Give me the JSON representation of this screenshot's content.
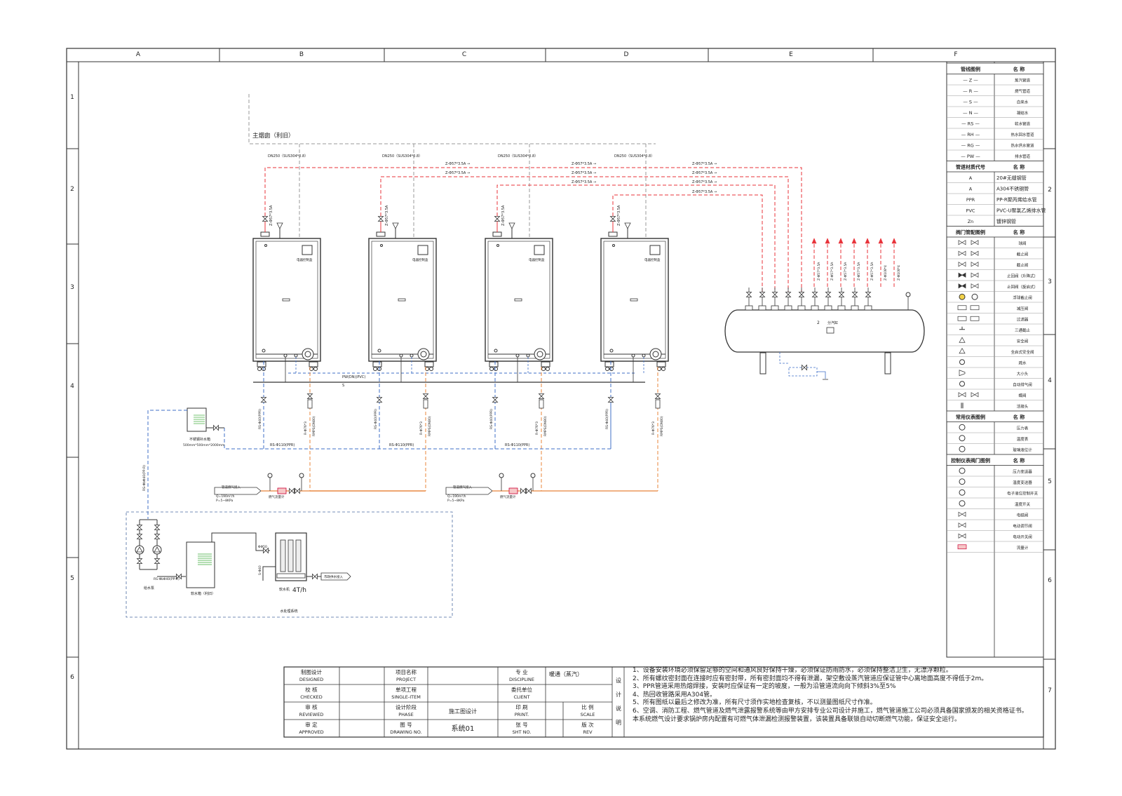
{
  "frame": {
    "columns": [
      "A",
      "B",
      "C",
      "D",
      "E",
      "F"
    ],
    "rows_left": [
      "1",
      "2",
      "3",
      "4",
      "5",
      "6"
    ],
    "rows_right": [
      "2",
      "3",
      "4",
      "5",
      "6",
      "7"
    ]
  },
  "top": {
    "main_flue": "主烟囱（利旧）",
    "flue_labels": [
      "DN250（SUS304*0.8）",
      "DN250（SUS304*0.8）",
      "DN250（SUS304*0.8）",
      "DN250（SUS304*0.8）"
    ],
    "steam_labels": [
      "Z-Φ57*3.5A →",
      "Z-Φ57*3.5A →",
      "Z-Φ57*3.5A →",
      "Z-Φ57*3.5A →",
      "Z-Φ57*3.5A →",
      "Z-Φ57*3.5A →",
      "Z-Φ57*3.5A →",
      "Z-Φ57*3.5A →",
      "Z-Φ57*3.5A →"
    ]
  },
  "boiler": {
    "panel_label": "电器控制盒",
    "steam_tag": "Z-Φ57*3.5A",
    "rs_tag": "RS-Φ40(PPR)",
    "r_tag": "R-Φ76*3",
    "gas_tag": "RMPS(DN80)"
  },
  "middle": {
    "pw_label": "PW(DN)(PVC)",
    "s_label": "S",
    "rs_main": [
      "RS-Φ110(PPR)",
      "RS-Φ110(PPR)",
      "RS-Φ110(PPR)"
    ],
    "tank_name": "不锈钢补水箱",
    "tank_size": "500mm*500mm*2000mm",
    "rs_vertical": "RS-ΦbΦ40(PP-R)"
  },
  "gas": {
    "entry_label": "管道燃气接入",
    "flow": "Q=190m³/h",
    "pressure": "P=5~8KPa",
    "meter": "燃气流量计"
  },
  "water": {
    "pump": "给水泵",
    "softener_tank": "软水箱（利旧）",
    "softener_tag": "RS-ΦbΦ40(PP-R)",
    "unit_name": "软水机",
    "capacity": "4T/h",
    "inlet": "市政供水接入",
    "dn_label": "ΦΦ50",
    "sdn_label": "S-Φ40",
    "system_name": "水处理系统"
  },
  "header": {
    "tags": [
      "Z-Φ57*3.5A",
      "Z-Φ57*3.5A",
      "Z-Φ57*3.5A",
      "Z-Φ57*3.5A",
      "Z-Φ57*3.5A",
      "Z-Φ108*4",
      "Z-Φ108*4"
    ],
    "number": "2",
    "name": "分汽缸"
  },
  "legend": {
    "pipe_header": [
      "管线图例",
      "名  称"
    ],
    "pipes": [
      [
        "— Z —",
        "蒸汽管道"
      ],
      [
        "— R —",
        "燃气管道"
      ],
      [
        "— S —",
        "自来水"
      ],
      [
        "— N —",
        "凝结水"
      ],
      [
        "— RS —",
        "软水管道"
      ],
      [
        "— RH —",
        "热水回水管道"
      ],
      [
        "— RG —",
        "热水供水管道"
      ],
      [
        "— PW —",
        "排水管道"
      ]
    ],
    "material_header": [
      "管道材质代号",
      "名  称"
    ],
    "materials": [
      [
        "A",
        "20#无缝钢管"
      ],
      [
        "A",
        "A304不锈钢管"
      ],
      [
        "PPR",
        "PP-R聚丙烯给水管"
      ],
      [
        "PVC",
        "PVC-U聚氯乙烯排水管"
      ],
      [
        "Zn",
        "镀锌钢管"
      ]
    ],
    "valve_header": [
      "阀门管配图例",
      "名  称"
    ],
    "valves": [
      "球阀",
      "截止阀",
      "截止阀",
      "止回阀（升降式）",
      "止回阀（旋启式）",
      "浮球截止阀",
      "减压阀",
      "过滤器",
      "三通截止",
      "安全阀",
      "全启式安全阀",
      "疏水",
      "大小头",
      "自动排气阀",
      "蝶阀",
      "活接头"
    ],
    "instrument_header": [
      "常用仪表图例",
      "名  称"
    ],
    "instruments": [
      "压力表",
      "温度表",
      "玻璃液位计"
    ],
    "control_header": [
      "控制仪表阀门图例",
      "名  称"
    ],
    "controls": [
      "压力变送器",
      "温度变送器",
      "电子液位控制开关",
      "温度开关",
      "电磁阀",
      "电动调节阀",
      "电动开关阀",
      "流量计"
    ]
  },
  "title_block": {
    "rows": [
      {
        "cn": "制图设计",
        "en": "DESIGNED",
        "k1cn": "项目名称",
        "k1en": "PROJECT",
        "v1": "",
        "k2cn": "专  业",
        "k2en": "DISCIPLINE",
        "v2": "暖通（蒸汽）"
      },
      {
        "cn": "校  核",
        "en": "CHECKED",
        "k1cn": "单项工程",
        "k1en": "SINGLE-ITEM",
        "v1": "",
        "k2cn": "委托单位",
        "k2en": "CLIENT",
        "v2": ""
      },
      {
        "cn": "审  核",
        "en": "REVIEWED",
        "k1cn": "设计阶段",
        "k1en": "PHASE",
        "v1": "施工图设计",
        "k2cn": "印  刷",
        "k2en": "PRINT.",
        "v2": ""
      },
      {
        "cn": "审  定",
        "en": "APPROVED",
        "k1cn": "图  号",
        "k1en": "DRAWING NO.",
        "v1": "系统01",
        "k2cn": "张  号",
        "k2en": "SHT NO.",
        "v2": ""
      }
    ],
    "scale": {
      "cn": "比  例",
      "en": "SCALE"
    },
    "rev": {
      "cn": "版  次",
      "en": "REV"
    },
    "side_label": "设计说明"
  },
  "notes": [
    "1、设备安装环境必须保留足够的空间和通风良好保持干燥，必须保证防雨防水，必须保持整洁卫生，无漂浮颗粒。",
    "2、所有螺纹密封面在连接时应有密封带，所有密封面均不得有泄漏，架空敷设蒸汽管道应保证管中心离地面高度不得低于2m。",
    "3、PPR管道采用热熔焊接，安装时应保证有一定的坡度，一般为沿管道流向向下倾斜3%至5%",
    "4、热回收管路采用A304管。",
    "5、所有图纸以最后之修改为准，所有尺寸须作实地检查复核，不以测量图纸尺寸作准。",
    "6、空调、消防工程、燃气管道及燃气泄露报警系统等由甲方安排专业公司设计并施工，燃气管道施工公司必须具备国家颁发的相关资格证书。",
    "本系统燃气设计要求锅炉房内配置有可燃气体泄漏检测报警装置，该装置具备联锁自动切断燃气功能，保证安全运行。"
  ],
  "colors": {
    "steam": "#e8333a",
    "water": "#3f6fc7",
    "gas": "#e8843a",
    "flue": "#9a9a9a",
    "line": "#333333",
    "green": "#39a935"
  }
}
